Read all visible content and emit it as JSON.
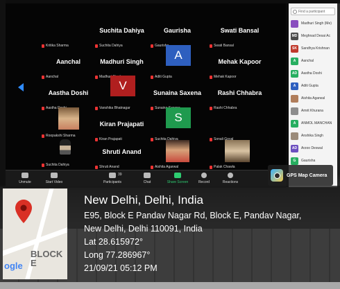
{
  "participant_search": {
    "placeholder": "Find a participant"
  },
  "gallery": {
    "tiles": [
      {
        "big": "",
        "small": "Kritika Sharma"
      },
      {
        "big": "Suchita Dahiya",
        "small": "Suchita Dahiya"
      },
      {
        "big": "Gaurisha",
        "small": "Gaurisha"
      },
      {
        "big": "Swati Bansal",
        "small": "Swati Bansal"
      },
      {
        "big": "Aanchal",
        "small": "Aanchal"
      },
      {
        "big": "Madhuri Singh",
        "small": "Madhuri Singh"
      },
      {
        "big": "A",
        "small": "Aditi Gupta"
      },
      {
        "big": "Mehak Kapoor",
        "small": "Mehak Kapoor"
      },
      {
        "big": "Aastha Doshi",
        "small": "Aastha Doshi"
      },
      {
        "big": "V",
        "small": "Vanshika Bhatnagar"
      },
      {
        "big": "Sunaina Saxena",
        "small": "Sunaina Saxena"
      },
      {
        "big": "Rashi Chhabra",
        "small": "Rashi Chhabra"
      },
      {
        "big": "",
        "small": "Roopakshi Sharma"
      },
      {
        "big": "Kiran Prajapati",
        "small": "Kiran Prajapati"
      },
      {
        "big": "S",
        "small": "Suchita Dahiya"
      },
      {
        "big": "",
        "small": "Sonali Goyal"
      },
      {
        "big": "",
        "small": "Suchita Dahiya"
      },
      {
        "big": "Shruti Anand",
        "small": "Shruti Anand"
      },
      {
        "big": "",
        "small": "Aishita Agarwal"
      },
      {
        "big": "",
        "small": "Palak Chawla"
      }
    ]
  },
  "toolbar": {
    "unmute": "Unmute",
    "start_video": "Start Video",
    "participants": "Participants",
    "participants_count": "39",
    "chat": "Chat",
    "share_screen": "Share Screen",
    "record": "Record",
    "reactions": "Reactions"
  },
  "participants_panel": {
    "items": [
      {
        "initials": "",
        "name": "Madhuri Singh (Me)",
        "color": "#8a4fbf"
      },
      {
        "initials": "MD",
        "name": "Meghnad Desai Ac",
        "color": "#4a4a4a"
      },
      {
        "initials": "SK",
        "name": "Sandhya Krishnan",
        "color": "#c0392b"
      },
      {
        "initials": "A",
        "name": "Aanchal",
        "color": "#27ae60"
      },
      {
        "initials": "AD",
        "name": "Aastha Doshi",
        "color": "#27ae60"
      },
      {
        "initials": "A",
        "name": "Aditi Gupta",
        "color": "#2e5fbf"
      },
      {
        "initials": "",
        "name": "Aishita Agarwal",
        "color": "#b07d5b"
      },
      {
        "initials": "",
        "name": "Amrit Khurana",
        "color": "#8d8d8d"
      },
      {
        "initials": "A",
        "name": "ANMOL MANCHAN",
        "color": "#27ae60"
      },
      {
        "initials": "",
        "name": "Anshika Singh",
        "color": "#9b8b7a"
      },
      {
        "initials": "AD",
        "name": "Arzoo Deswal",
        "color": "#6c4fbf"
      },
      {
        "initials": "G",
        "name": "Gaurisha",
        "color": "#27ae60"
      }
    ]
  },
  "gps_camera": {
    "label": "GPS Map Camera"
  },
  "map": {
    "label_block": "BLOCK E",
    "label_google": "ogle"
  },
  "location": {
    "title": "New Delhi, Delhi, India",
    "address_line1": "E95, Block E Pandav Nagar Rd, Block E, Pandav Nagar,",
    "address_line2": "New Delhi, Delhi 110091, India",
    "lat": "Lat 28.615972°",
    "long": "Long 77.286967°",
    "datetime": "21/09/21 05:12 PM"
  },
  "colors": {
    "pin": "#d93025",
    "share_green": "#2ecc71",
    "arrow_blue": "#2f8cff"
  }
}
